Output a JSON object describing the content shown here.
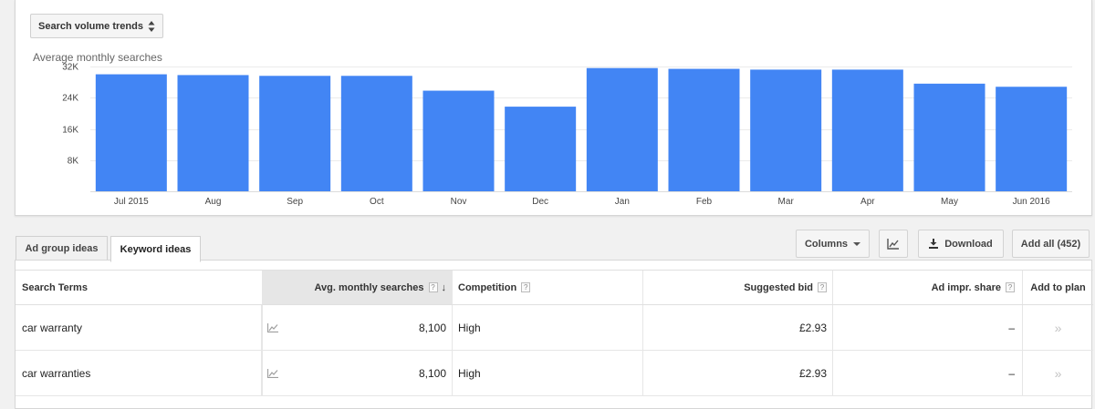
{
  "chart": {
    "selector_label": "Search volume trends",
    "title": "Average monthly searches"
  },
  "chart_data": {
    "type": "bar",
    "categories": [
      "Jul 2015",
      "Aug",
      "Sep",
      "Oct",
      "Nov",
      "Dec",
      "Jan",
      "Feb",
      "Mar",
      "Apr",
      "May",
      "Jun 2016"
    ],
    "values": [
      30000,
      29800,
      29600,
      29600,
      25800,
      21700,
      31600,
      31400,
      31200,
      31200,
      27600,
      26800
    ],
    "ylabel": "Average monthly searches",
    "yticks": [
      "8K",
      "16K",
      "24K",
      "32K"
    ],
    "ytick_values": [
      8000,
      16000,
      24000,
      32000
    ],
    "ylim": [
      0,
      32000
    ],
    "grid": true,
    "color": "#4285f4"
  },
  "tabs": [
    {
      "label": "Ad group ideas",
      "active": false
    },
    {
      "label": "Keyword ideas",
      "active": true
    }
  ],
  "toolbar": {
    "columns_label": "Columns",
    "download_label": "Download",
    "add_all_label": "Add all (452)"
  },
  "table": {
    "headers": {
      "term": "Search Terms",
      "avg": "Avg. monthly searches",
      "competition": "Competition",
      "bid": "Suggested bid",
      "share": "Ad impr. share",
      "plan": "Add to plan"
    },
    "help_glyph": "?",
    "sort_glyph": "↓",
    "rows": [
      {
        "term": "car warranty",
        "avg": "8,100",
        "competition": "High",
        "bid": "£2.93",
        "share": "–",
        "plan": "»"
      },
      {
        "term": "car warranties",
        "avg": "8,100",
        "competition": "High",
        "bid": "£2.93",
        "share": "–",
        "plan": "»"
      }
    ]
  }
}
